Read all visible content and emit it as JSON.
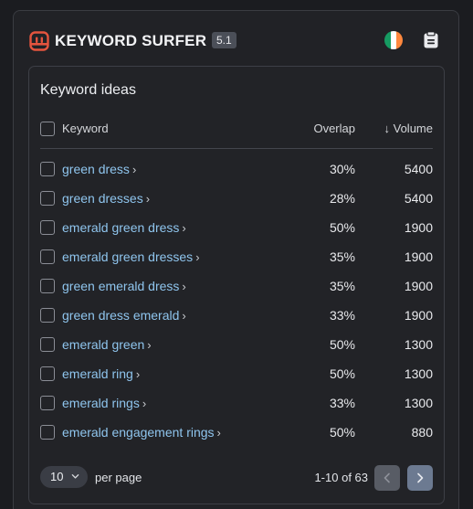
{
  "app": {
    "brand": "KEYWORD SURFER",
    "version": "5.1"
  },
  "colors": {
    "accent": "#e4543e",
    "link": "#8fc5ee",
    "flag": [
      "#169b62",
      "#ffffff",
      "#ff883e"
    ]
  },
  "icons": {
    "logo": "keyword-surfer-logo-icon",
    "flag": "ireland-flag-icon",
    "notes": "notes-icon"
  },
  "card": {
    "title": "Keyword ideas"
  },
  "table": {
    "headers": {
      "keyword": "Keyword",
      "overlap": "Overlap",
      "volume": "↓ Volume"
    },
    "rows": [
      {
        "keyword": "green dress",
        "overlap": "30%",
        "volume": "5400"
      },
      {
        "keyword": "green dresses",
        "overlap": "28%",
        "volume": "5400"
      },
      {
        "keyword": "emerald green dress",
        "overlap": "50%",
        "volume": "1900"
      },
      {
        "keyword": "emerald green dresses",
        "overlap": "35%",
        "volume": "1900"
      },
      {
        "keyword": "green emerald dress",
        "overlap": "35%",
        "volume": "1900"
      },
      {
        "keyword": "green dress emerald",
        "overlap": "33%",
        "volume": "1900"
      },
      {
        "keyword": "emerald green",
        "overlap": "50%",
        "volume": "1300"
      },
      {
        "keyword": "emerald ring",
        "overlap": "50%",
        "volume": "1300"
      },
      {
        "keyword": "emerald rings",
        "overlap": "33%",
        "volume": "1300"
      },
      {
        "keyword": "emerald engagement rings",
        "overlap": "50%",
        "volume": "880"
      }
    ]
  },
  "pagination": {
    "per_page_value": "10",
    "per_page_label": "per page",
    "range": "1-10 of 63"
  }
}
